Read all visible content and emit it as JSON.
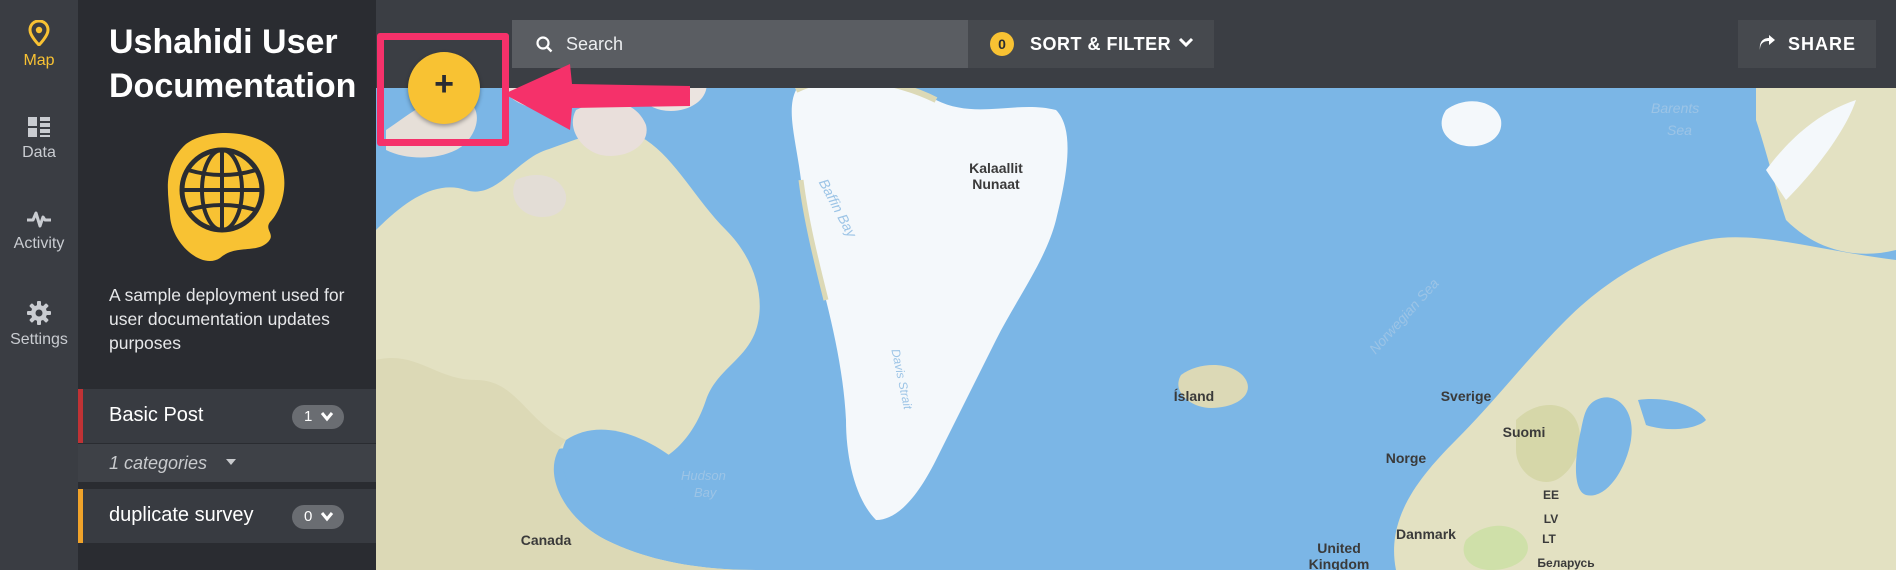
{
  "nav": {
    "items": [
      {
        "label": "Map",
        "icon": "map-pin-icon",
        "active": true
      },
      {
        "label": "Data",
        "icon": "data-grid-icon"
      },
      {
        "label": "Activity",
        "icon": "activity-icon"
      },
      {
        "label": "Settings",
        "icon": "gear-icon"
      }
    ]
  },
  "deployment": {
    "title": "Ushahidi User Documentation",
    "description": "A sample deployment used for user documentation updates purposes"
  },
  "surveys": [
    {
      "name": "Basic Post",
      "count": "1",
      "accent": "#c03235"
    },
    {
      "name": "duplicate survey",
      "count": "0",
      "accent": "#f0a32a"
    }
  ],
  "categories": {
    "label": "1 categories"
  },
  "toolbar": {
    "search_placeholder": "Search",
    "filter_count": "0",
    "sort_filter_label": "SORT & FILTER",
    "share_label": "SHARE"
  },
  "fab": {
    "label": "+"
  },
  "map": {
    "labels": {
      "kalaallit": "Kalaallit",
      "nunaat": "Nunaat",
      "island": "Ísland",
      "canada": "Canada",
      "sverige": "Sverige",
      "suomi": "Suomi",
      "norge": "Norge",
      "danmark": "Danmark",
      "united": "United",
      "kingdom": "Kingdom",
      "ee": "EE",
      "lv": "LV",
      "lt": "LT",
      "belarus": "Беларусь"
    },
    "seas": {
      "baffin": "Baffin Bay",
      "davis": "Davis Strait",
      "hudson": "Hudson",
      "hudson_bay": "Bay",
      "norwegian": "Norwegian Sea",
      "barents": "Barents",
      "barents_sea": "Sea"
    }
  },
  "colors": {
    "accent": "#f8c233",
    "highlight": "#f5316a",
    "water": "#7bb6e6",
    "land": "#e3e1c2",
    "ice": "#f4f8fb"
  }
}
